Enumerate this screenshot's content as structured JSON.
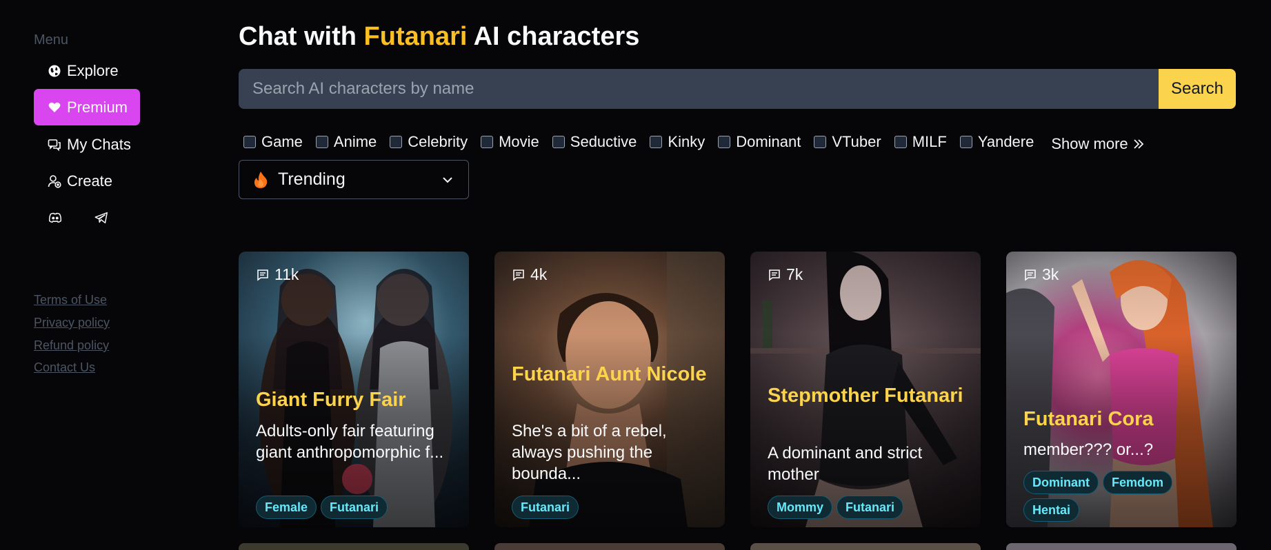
{
  "sidebar": {
    "menu_title": "Menu",
    "items": [
      {
        "label": "Explore"
      },
      {
        "label": "Premium"
      },
      {
        "label": "My Chats"
      },
      {
        "label": "Create"
      }
    ],
    "footer_links": [
      "Terms of Use",
      "Privacy policy",
      "Refund policy",
      "Contact Us"
    ]
  },
  "header": {
    "title_prefix": "Chat with ",
    "title_accent": "Futanari",
    "title_suffix": " AI characters"
  },
  "search": {
    "placeholder": "Search AI characters by name",
    "button_label": "Search"
  },
  "filters": [
    "Game",
    "Anime",
    "Celebrity",
    "Movie",
    "Seductive",
    "Kinky",
    "Dominant",
    "VTuber",
    "MILF",
    "Yandere"
  ],
  "show_more_label": "Show more",
  "sort": {
    "selected": "Trending"
  },
  "cards": [
    {
      "count": "11k",
      "name": "Giant Furry Fair",
      "description": "Adults-only fair featuring giant anthropomorphic f...",
      "tags": [
        "Female",
        "Futanari"
      ]
    },
    {
      "count": "4k",
      "name": "Futanari Aunt Nicole",
      "description": "She's a bit of a rebel, always pushing the bounda...",
      "tags": [
        "Futanari"
      ]
    },
    {
      "count": "7k",
      "name": "Stepmother Futanari",
      "description": "A dominant and strict mother",
      "tags": [
        "Mommy",
        "Futanari"
      ]
    },
    {
      "count": "3k",
      "name": "Futanari Cora",
      "description": "member??? or...?",
      "tags": [
        "Dominant",
        "Femdom",
        "Hentai"
      ]
    }
  ],
  "colors": {
    "background": "#060609",
    "accent_yellow": "#fcd34d",
    "premium_pink": "#d946ef",
    "search_bg": "#374151",
    "tag_text": "#67e8f9"
  },
  "icons": {
    "explore": "globe-icon",
    "premium": "heart-icon",
    "my_chats": "chat-bubbles-icon",
    "create": "user-plus-icon",
    "discord": "discord-icon",
    "telegram": "telegram-icon",
    "show_more": "double-chevron-right-icon",
    "sort": "fire-icon",
    "dropdown": "chevron-down-icon",
    "message_count": "message-icon"
  }
}
